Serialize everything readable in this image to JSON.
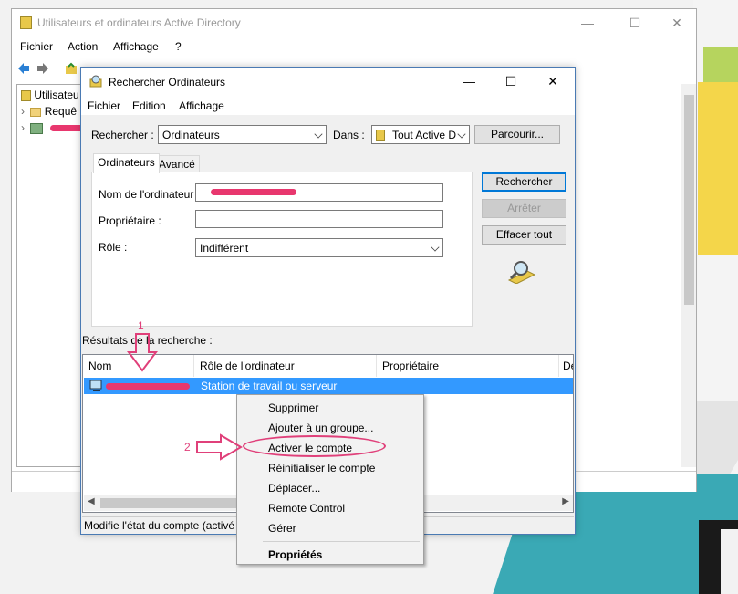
{
  "colors": {
    "accent": "#3399ff",
    "annotation": "#e0407a"
  },
  "main_window": {
    "title": "Utilisateurs et ordinateurs Active Directory",
    "menu": [
      "Fichier",
      "Action",
      "Affichage",
      "?"
    ],
    "tree": {
      "item1": "Utilisateu",
      "item2": "Requê"
    }
  },
  "dialog": {
    "title": "Rechercher Ordinateurs",
    "menu": [
      "Fichier",
      "Edition",
      "Affichage"
    ],
    "search_label": "Rechercher :",
    "search_value": "Ordinateurs",
    "in_label": "Dans :",
    "in_value": "Tout Active D",
    "browse_button": "Parcourir...",
    "tabs": [
      "Ordinateurs",
      "Avancé"
    ],
    "fields": {
      "computer_name_label": "Nom de l'ordinateur :",
      "owner_label": "Propriétaire :",
      "role_label": "Rôle :",
      "role_value": "Indifférent"
    },
    "buttons": {
      "search": "Rechercher",
      "stop": "Arrêter",
      "clear": "Effacer tout"
    },
    "results_label": "Résultats de la recherche :",
    "columns": [
      "Nom",
      "Rôle de l'ordinateur",
      "Propriétaire",
      "De"
    ],
    "row": {
      "role": "Station de travail ou serveur"
    },
    "status": "Modifie l'état du compte (activé"
  },
  "context_menu": {
    "items": [
      "Supprimer",
      "Ajouter à un groupe...",
      "Activer le compte",
      "Réinitialiser le compte",
      "Déplacer...",
      "Remote Control",
      "Gérer",
      "Propriétés"
    ]
  },
  "annotations": {
    "step1": "1",
    "step2": "2"
  }
}
